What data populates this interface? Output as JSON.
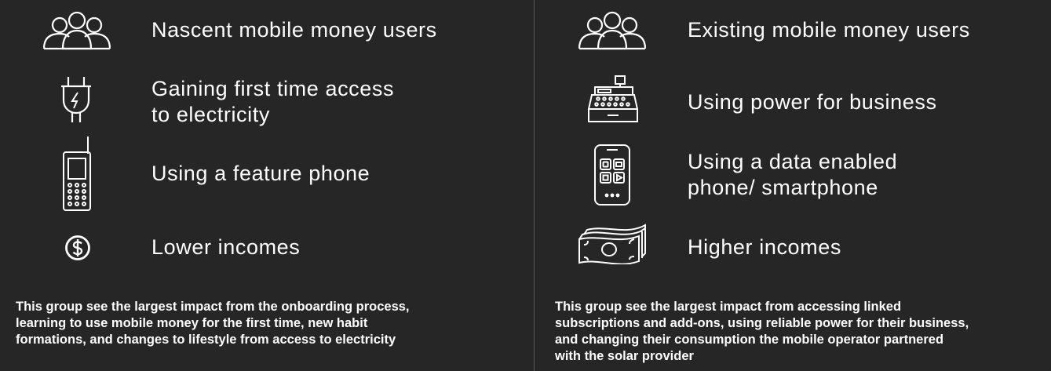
{
  "left": {
    "items": [
      {
        "icon": "users-group-icon",
        "label": "Nascent mobile money users"
      },
      {
        "icon": "plug-lightning-icon",
        "label_line1": "Gaining first time access",
        "label_line2": "to electricity"
      },
      {
        "icon": "feature-phone-icon",
        "label": "Using a feature phone"
      },
      {
        "icon": "dollar-coin-icon",
        "label": "Lower incomes"
      }
    ],
    "description": {
      "line1": "This group see the largest impact from the onboarding process,",
      "line2": "learning to use mobile money for the first time, new habit",
      "line3": "formations, and changes to lifestyle from access to electricity"
    }
  },
  "right": {
    "items": [
      {
        "icon": "users-group-icon",
        "label": "Existing mobile money users"
      },
      {
        "icon": "cash-register-icon",
        "label": "Using power for business"
      },
      {
        "icon": "smartphone-icon",
        "label_line1": "Using a data enabled",
        "label_line2": "phone/ smartphone"
      },
      {
        "icon": "banknotes-icon",
        "label": "Higher incomes"
      }
    ],
    "description": {
      "line1": "This group see the largest impact from accessing linked",
      "line2": "subscriptions and add-ons, using reliable power for their business,",
      "line3": "and changing their consumption the mobile operator partnered",
      "line4": "with the solar provider"
    }
  },
  "colors": {
    "background": "#262626",
    "text": "#ffffff",
    "divider": "#5a5a5a"
  }
}
